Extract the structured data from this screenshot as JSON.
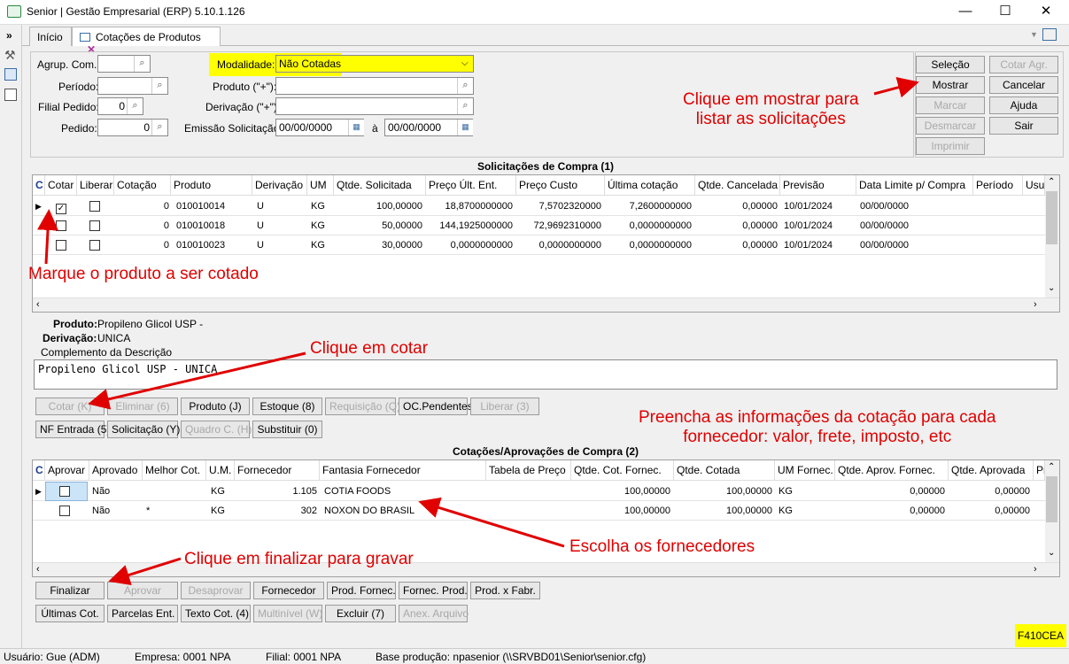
{
  "window": {
    "title": "Senior | Gestão Empresarial (ERP) 5.10.1.126",
    "minimize": "—",
    "maximize": "☐",
    "close": "✕"
  },
  "tabs": [
    {
      "label": "Início"
    },
    {
      "label": "Cotações de Produtos"
    }
  ],
  "filters": {
    "agrup_com": {
      "label": "Agrup. Com.:",
      "value": ""
    },
    "periodo": {
      "label": "Período:",
      "value": ""
    },
    "filial_pedido": {
      "label": "Filial Pedido:",
      "value": "0"
    },
    "pedido": {
      "label": "Pedido:",
      "value": "0"
    },
    "modalidade": {
      "label": "Modalidade:",
      "value": "Não Cotadas"
    },
    "produto": {
      "label": "Produto (\"+\"):",
      "value": ""
    },
    "derivacao": {
      "label": "Derivação (\"+\"):",
      "value": ""
    },
    "emissao": {
      "label": "Emissão Solicitação:",
      "from": "00/00/0000",
      "to_label": "à",
      "to": "00/00/0000"
    }
  },
  "right_buttons": {
    "selecao": "Seleção",
    "cotar_agr": "Cotar Agr.",
    "mostrar": "Mostrar",
    "cancelar": "Cancelar",
    "marcar": "Marcar",
    "ajuda": "Ajuda",
    "desmarcar": "Desmarcar",
    "sair": "Sair",
    "imprimir": "Imprimir"
  },
  "solicitacoes": {
    "title": "Solicitações de Compra (1)",
    "columns": [
      "C",
      "Cotar",
      "Liberar",
      "Cotação",
      "Produto",
      "Derivação",
      "UM",
      "Qtde. Solicitada",
      "Preço Últ. Ent.",
      "Preço Custo",
      "Última cotação",
      "Qtde. Cancelada",
      "Previsão",
      "Data Limite p/ Compra",
      "Período",
      "Usu"
    ],
    "rows": [
      {
        "cotar": true,
        "cotacao": "0",
        "produto": "010010014",
        "derivacao": "U",
        "um": "KG",
        "qtde": "100,00000",
        "preco_ult": "18,8700000000",
        "preco_custo": "7,5702320000",
        "ultima": "7,2600000000",
        "cancelada": "0,00000",
        "previsao": "10/01/2024",
        "data_limite": "00/00/0000"
      },
      {
        "cotar": false,
        "cotacao": "0",
        "produto": "010010018",
        "derivacao": "U",
        "um": "KG",
        "qtde": "50,00000",
        "preco_ult": "144,1925000000",
        "preco_custo": "72,9692310000",
        "ultima": "0,0000000000",
        "cancelada": "0,00000",
        "previsao": "10/01/2024",
        "data_limite": "00/00/0000"
      },
      {
        "cotar": false,
        "cotacao": "0",
        "produto": "010010023",
        "derivacao": "U",
        "um": "KG",
        "qtde": "30,00000",
        "preco_ult": "0,0000000000",
        "preco_custo": "0,0000000000",
        "ultima": "0,0000000000",
        "cancelada": "0,00000",
        "previsao": "10/01/2024",
        "data_limite": "00/00/0000"
      }
    ]
  },
  "detail": {
    "produto_label": "Produto:",
    "produto_value": "Propileno Glicol USP -",
    "derivacao_label": "Derivação:",
    "derivacao_value": "UNICA",
    "complemento_label": "Complemento da Descrição",
    "complemento_value": "Propileno Glicol USP - UNICA"
  },
  "buttons_row1": [
    "Cotar (K)",
    "Eliminar (6)",
    "Produto (J)",
    "Estoque (8)",
    "Requisição (Q)",
    "OC.Pendentes",
    "Liberar (3)"
  ],
  "buttons_row2": [
    "NF Entrada (5)",
    "Solicitação (Y)",
    "Quadro C. (H)",
    "Substituir (0)"
  ],
  "cotacoes": {
    "title": "Cotações/Aprovações de Compra (2)",
    "columns": [
      "C",
      "Aprovar",
      "Aprovado",
      "Melhor Cot.",
      "U.M.",
      "Fornecedor",
      "Fantasia Fornecedor",
      "Tabela de Preço",
      "Qtde. Cot. Fornec.",
      "Qtde. Cotada",
      "UM Fornec.",
      "Qtde. Aprov. Fornec.",
      "Qtde. Aprovada",
      "Pr"
    ],
    "rows": [
      {
        "aprovado": "Não",
        "melhor": "",
        "um": "KG",
        "fornecedor": "1.105",
        "fantasia": "COTIA FOODS",
        "tabela": "",
        "qtde_cot_f": "100,00000",
        "qtde_cot": "100,00000",
        "um_f": "KG",
        "qtde_ap_f": "0,00000",
        "qtde_ap": "0,00000"
      },
      {
        "aprovado": "Não",
        "melhor": "*",
        "um": "KG",
        "fornecedor": "302",
        "fantasia": "NOXON DO BRASIL",
        "tabela": "",
        "qtde_cot_f": "100,00000",
        "qtde_cot": "100,00000",
        "um_f": "KG",
        "qtde_ap_f": "0,00000",
        "qtde_ap": "0,00000"
      }
    ]
  },
  "buttons_row3": [
    "Finalizar",
    "Aprovar",
    "Desaprovar",
    "Fornecedor",
    "Prod. Fornec.",
    "Fornec. Prod.",
    "Prod. x Fabr."
  ],
  "buttons_row4": [
    "Últimas Cot.",
    "Parcelas Ent.",
    "Texto Cot. (4)",
    "Multinível (W)",
    "Excluir (7)",
    "Anex. Arquivo"
  ],
  "screen_code": "F410CEA",
  "status": {
    "usuario": "Usuário: Gue (ADM)",
    "empresa": "Empresa: 0001 NPA",
    "filial": "Filial: 0001 NPA",
    "base": "Base produção: npasenior (\\\\SRVBD01\\Senior\\senior.cfg)"
  },
  "annotations": {
    "mostrar": "Clique em mostrar para\nlistar as solicitações",
    "marque": "Marque o produto a ser cotado",
    "cotar": "Clique em cotar",
    "preencha": "Preencha as informações da cotação para cada\nfornecedor: valor, frete, imposto, etc",
    "escolha": "Escolha os fornecedores",
    "finalizar": "Clique em finalizar para gravar"
  },
  "colors": {
    "annotation": "#e00000",
    "highlight": "#ffff00"
  }
}
